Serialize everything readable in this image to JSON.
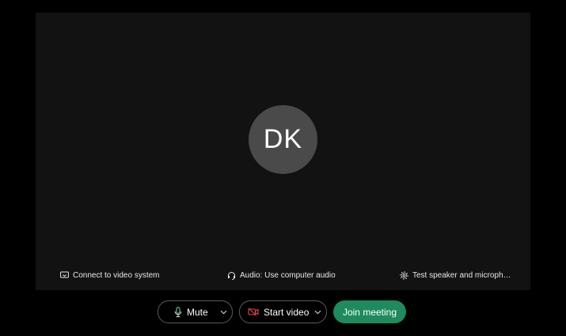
{
  "preview": {
    "avatar_initials": "DK",
    "options": {
      "connect_label": "Connect to video system",
      "audio_label": "Audio: Use computer audio",
      "test_label": "Test speaker and micropho..."
    }
  },
  "controls": {
    "mute_label": "Mute",
    "video_label": "Start video",
    "join_label": "Join meeting"
  },
  "icons": {
    "connect": "cast-screen-icon",
    "audio": "headset-icon",
    "test": "gear-icon",
    "mute": "microphone-icon",
    "video": "video-off-icon",
    "caret": "chevron-down-icon"
  },
  "colors": {
    "background": "#000000",
    "preview": "#121212",
    "avatar": "#4a4a4a",
    "join": "#1e8a5e",
    "mic_accent": "#6fcf97",
    "video_off": "#e5484d"
  }
}
